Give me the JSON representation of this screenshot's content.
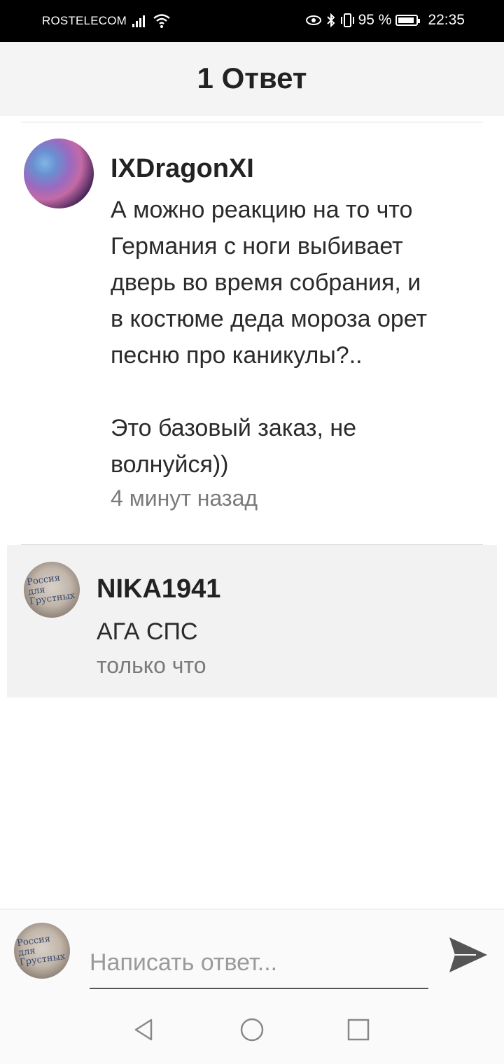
{
  "status_bar": {
    "carrier": "ROSTELECOM",
    "battery": "95 %",
    "time": "22:35"
  },
  "header": {
    "title": "1 Ответ"
  },
  "comment": {
    "username": "IXDragonXI",
    "text": "А можно реакцию на то что\nГермания с ноги выбивает\nдверь во время собрания, и\nв костюме деда мороза орет\nпесню про каникулы?..\n\nЭто базовый заказ, не\nволнуйся))",
    "time": "4 минут назад"
  },
  "reply": {
    "username": "NIKA1941",
    "text": "АГА СПС",
    "time": "только что"
  },
  "composer": {
    "placeholder": "Написать ответ..."
  },
  "colors": {
    "header_bg": "#f4f4f4",
    "reply_bg": "#f2f2f2",
    "send_icon": "#555555"
  }
}
